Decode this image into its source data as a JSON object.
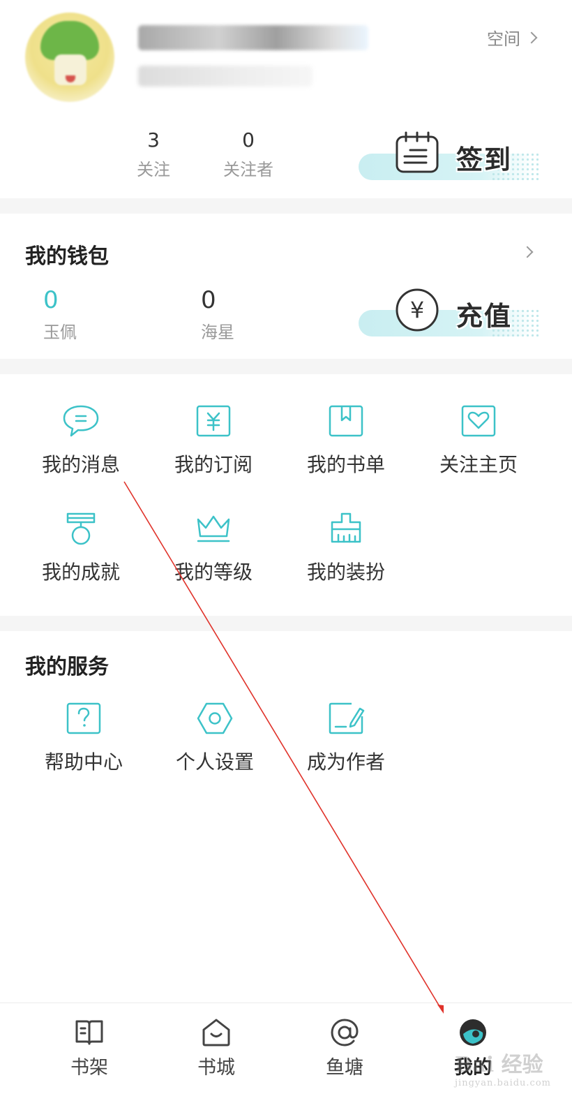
{
  "profile": {
    "space_label": "空间",
    "stats": [
      {
        "num": "3",
        "label": "关注"
      },
      {
        "num": "0",
        "label": "关注者"
      }
    ],
    "checkin_label": "签到"
  },
  "wallet": {
    "title": "我的钱包",
    "items": [
      {
        "num": "0",
        "label": "玉佩"
      },
      {
        "num": "0",
        "label": "海星"
      }
    ],
    "recharge_label": "充值",
    "recharge_symbol": "¥"
  },
  "features": [
    {
      "label": "我的消息",
      "icon": "message-icon"
    },
    {
      "label": "我的订阅",
      "icon": "subscription-icon"
    },
    {
      "label": "我的书单",
      "icon": "booklist-icon"
    },
    {
      "label": "关注主页",
      "icon": "heart-icon"
    },
    {
      "label": "我的成就",
      "icon": "medal-icon"
    },
    {
      "label": "我的等级",
      "icon": "crown-icon"
    },
    {
      "label": "我的装扮",
      "icon": "brush-icon"
    }
  ],
  "services": {
    "title": "我的服务",
    "items": [
      {
        "label": "帮助中心",
        "icon": "help-icon"
      },
      {
        "label": "个人设置",
        "icon": "settings-icon"
      },
      {
        "label": "成为作者",
        "icon": "write-icon"
      }
    ]
  },
  "bottom_nav": [
    {
      "label": "书架",
      "icon": "bookshelf-icon"
    },
    {
      "label": "书城",
      "icon": "bookstore-icon"
    },
    {
      "label": "鱼塘",
      "icon": "fishpond-icon"
    },
    {
      "label": "我的",
      "icon": "profile-icon",
      "active": true
    }
  ],
  "watermark": {
    "text": "Bai 经验",
    "sub": "jingyan.baidu.com"
  },
  "colors": {
    "accent": "#3cc2c8",
    "annotation": "#e0322a"
  }
}
